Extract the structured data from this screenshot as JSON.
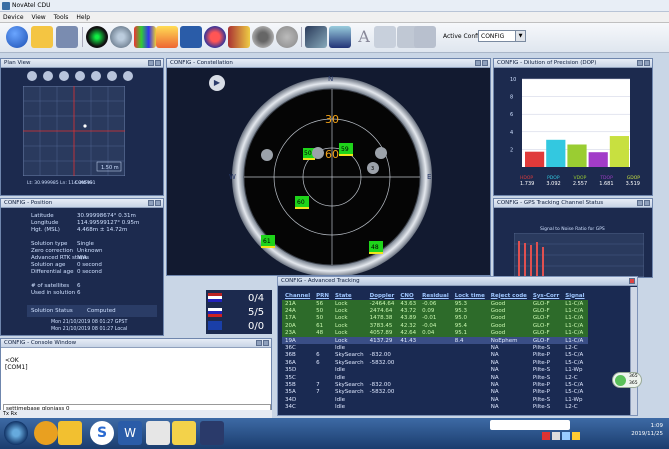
{
  "window": {
    "title": "NovAtel CDU"
  },
  "menu": [
    "Device",
    "View",
    "Tools",
    "Help"
  ],
  "toolbar": {
    "active_config_label": "Active Config",
    "active_config_value": "CONFIG"
  },
  "colors": {
    "panel_bg": "#1c2a4e",
    "lock_green": "#66e05a",
    "accent_yellow": "#f2e41a"
  },
  "plan_view": {
    "title": "Plan View",
    "scale_label": "1.50 m",
    "readout": "Lt: 30.999985  Ln: 114.995991",
    "legend": "CONFIG"
  },
  "constellation": {
    "title": "CONFIG - Constellation",
    "elev_labels": [
      "30",
      "60"
    ],
    "compass": [
      "N",
      "E",
      "S",
      "W"
    ],
    "sats": [
      {
        "prn": "59",
        "color": "green"
      },
      {
        "prn": "50",
        "color": "green"
      },
      {
        "prn": "60",
        "color": "green"
      },
      {
        "prn": "61",
        "color": "green"
      },
      {
        "prn": "48",
        "color": "green"
      },
      {
        "prn": "",
        "color": "gray"
      },
      {
        "prn": "",
        "color": "gray"
      },
      {
        "prn": "3",
        "color": "gray"
      }
    ]
  },
  "dop": {
    "title": "CONFIG - Dilution of Precision (DOP)",
    "yticks": [
      "10",
      "8",
      "6",
      "4",
      "2"
    ],
    "labels": [
      "HDOP",
      "PDOP",
      "VDOP",
      "TDOP",
      "GDOP"
    ],
    "values": [
      "1.739",
      "3.092",
      "2.557",
      "1.681",
      "3.519"
    ],
    "bar_colors": [
      "#e03a3a",
      "#33c8e0",
      "#9acd32",
      "#a23cc8",
      "#c8e040"
    ],
    "ymax": 10
  },
  "position": {
    "title": "CONFIG - Position",
    "rows": [
      {
        "label": "Latitude",
        "value": "30.99998674°  0.31m"
      },
      {
        "label": "Longitude",
        "value": "114.99599127°  0.95m"
      },
      {
        "label": "Hgt. (MSL)",
        "value": "4.468m ±  14.72m"
      },
      {
        "label": "Solution type",
        "value": "Single"
      },
      {
        "label": "Zero correction",
        "value": "Unknown"
      },
      {
        "label": "Advanced RTK status",
        "value": "N/A"
      },
      {
        "label": "Solution age",
        "value": "0 second"
      },
      {
        "label": "Differential age",
        "value": "0 second"
      },
      {
        "label": "# of satellites",
        "value": "6"
      },
      {
        "label": "Used in solution",
        "value": "6"
      }
    ],
    "solution_status_label": "Solution Status",
    "solution_status_value": "Computed",
    "time1": "Mon 21/10/2019 08 01:27 GPST",
    "time2": "Mon 21/10/2019 08 01:27 Local"
  },
  "signal_summary": {
    "a": "0/4",
    "b": "5/5",
    "c": "0/0"
  },
  "tracking": {
    "title": "CONFIG - GPS Tracking Channel Status",
    "chart_label": "Signal to Noise Ratio for GPS"
  },
  "console": {
    "title": "CONFIG - Console Window",
    "lines": [
      "<OK",
      "[COM1]"
    ],
    "command": "settimebase gloniass 0"
  },
  "status_strip": "Tx   Rx",
  "advanced": {
    "title": "CONFIG - Advanced Tracking",
    "headers": [
      "Channel",
      "PRN",
      "State",
      "Doppler",
      "CNO",
      "Residual",
      "Lock time",
      "Reject code",
      "Sys-Corr",
      "Signal"
    ],
    "rows": [
      [
        "21A",
        "56",
        "Lock",
        "-2464.64",
        "43.63",
        "-0.06",
        "95.3",
        "Good",
        "GLO-F",
        "L1-C/A"
      ],
      [
        "24A",
        "50",
        "Lock",
        "2474.64",
        "43.72",
        "0.09",
        "95.3",
        "Good",
        "GLO-F",
        "L1-C/A"
      ],
      [
        "17A",
        "50",
        "Lock",
        "1478.38",
        "43.89",
        "-0.01",
        "95.0",
        "Good",
        "GLO-F",
        "L1-C/A"
      ],
      [
        "20A",
        "61",
        "Lock",
        "3783.45",
        "42.32",
        "-0.04",
        "95.4",
        "Good",
        "GLO-F",
        "L1-C/A"
      ],
      [
        "23A",
        "48",
        "Lock",
        "4057.89",
        "42.64",
        "0.04",
        "95.1",
        "Good",
        "GLO-F",
        "L1-C/A"
      ],
      [
        "19A",
        "",
        "Lock",
        "4137.29",
        "41.43",
        "",
        "8.4",
        "NoEphem",
        "GLO-F",
        "L1-C/A"
      ],
      [
        "36C",
        "",
        "Idle",
        "",
        "",
        "",
        "",
        "NA",
        "Pilte-S",
        "L2-C"
      ],
      [
        "36B",
        "6",
        "SkySearch",
        "-832.00",
        "",
        "",
        "",
        "NA",
        "Pilte-P",
        "L5-C/A"
      ],
      [
        "36A",
        "6",
        "SkySearch",
        "-5832.00",
        "",
        "",
        "",
        "NA",
        "Pilte-P",
        "L5-C/A"
      ],
      [
        "35D",
        "",
        "Idle",
        "",
        "",
        "",
        "",
        "NA",
        "Pilte-S",
        "L1-Wp"
      ],
      [
        "35C",
        "",
        "Idle",
        "",
        "",
        "",
        "",
        "NA",
        "Pilte-S",
        "L2-C"
      ],
      [
        "35B",
        "7",
        "SkySearch",
        "-832.00",
        "",
        "",
        "",
        "NA",
        "Pilte-P",
        "L5-C/A"
      ],
      [
        "35A",
        "7",
        "SkySearch",
        "-5832.00",
        "",
        "",
        "",
        "NA",
        "Pilte-P",
        "L5-C/A"
      ],
      [
        "34D",
        "",
        "Idle",
        "",
        "",
        "",
        "",
        "NA",
        "Pilte-S",
        "L1-Wp"
      ],
      [
        "34C",
        "",
        "Idle",
        "",
        "",
        "",
        "",
        "NA",
        "Pilte-S",
        "L2-C"
      ]
    ]
  },
  "net_badge": [
    "365",
    "365"
  ],
  "clock": {
    "time": "1:09",
    "date": "2019/11/25"
  }
}
